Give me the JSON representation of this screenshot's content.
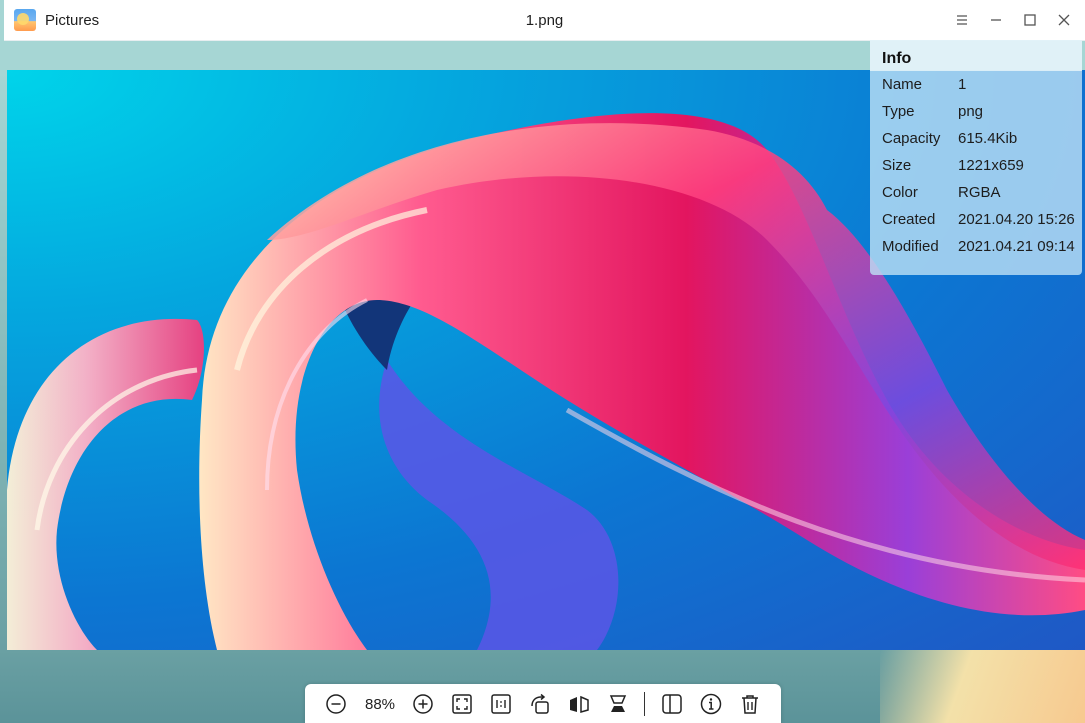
{
  "titlebar": {
    "app_name": "Pictures",
    "file_name": "1.png",
    "icons": [
      "pictures-app-icon",
      "menu-icon",
      "minimize-icon",
      "maximize-icon",
      "close-icon"
    ]
  },
  "info_panel": {
    "title": "Info",
    "rows": [
      {
        "key": "Name",
        "value": "1"
      },
      {
        "key": "Type",
        "value": "png"
      },
      {
        "key": "Capacity",
        "value": "615.4Kib"
      },
      {
        "key": "Size",
        "value": "1221x659"
      },
      {
        "key": "Color",
        "value": "RGBA"
      },
      {
        "key": "Created",
        "value": "2021.04.20 15:26"
      },
      {
        "key": "Modified",
        "value": "2021.04.21 09:14"
      }
    ]
  },
  "toolbar": {
    "zoom_level": "88%",
    "icons": [
      "zoom-out-icon",
      "zoom-in-icon",
      "fit-window-icon",
      "original-size-icon",
      "rotate-icon",
      "flip-horizontal-icon",
      "flip-vertical-icon",
      "sidebar-icon",
      "info-icon",
      "delete-icon"
    ]
  },
  "colors": {
    "accent_pink": "#ff2a7a",
    "background_blue": "#0c76d2"
  }
}
